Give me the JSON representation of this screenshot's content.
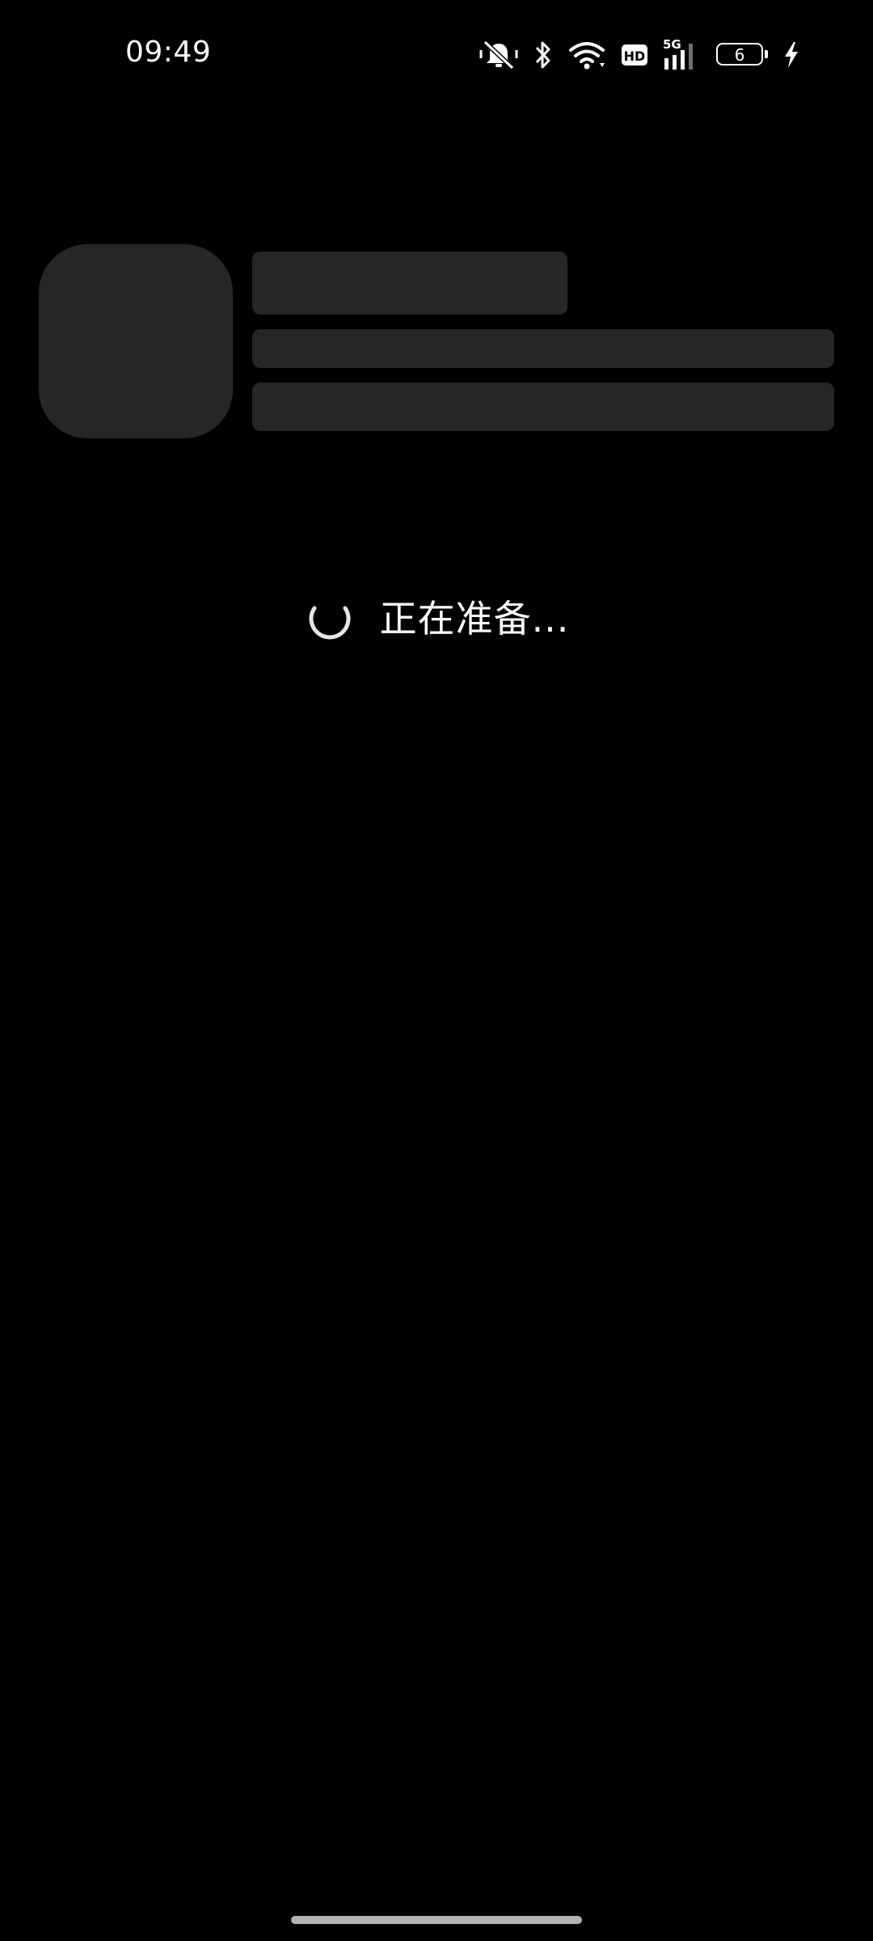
{
  "status_bar": {
    "time": "09:49",
    "battery_level": "6",
    "network_type": "5G",
    "hd_label": "HD",
    "icons": [
      "mute-icon",
      "bluetooth-icon",
      "wifi-icon",
      "hd-icon",
      "signal-icon",
      "battery-icon",
      "charging-icon"
    ]
  },
  "loading": {
    "text": "正在准备..."
  },
  "colors": {
    "background": "#000000",
    "skeleton": "#262626",
    "text": "#ffffff",
    "home_indicator": "#b3b3b3"
  }
}
